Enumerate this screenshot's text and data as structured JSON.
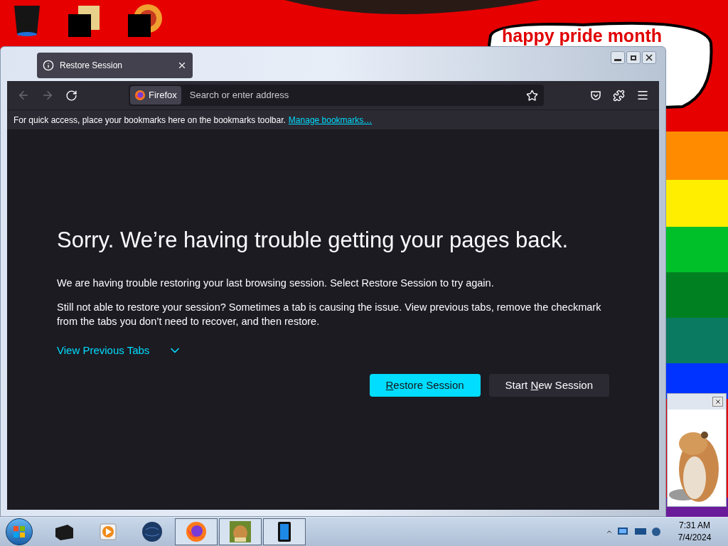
{
  "desktop": {
    "banner_text": "happy pride month",
    "icons": [
      {
        "kind": "bin"
      },
      {
        "kind": "folder"
      },
      {
        "kind": "globe"
      }
    ]
  },
  "window": {
    "tab": {
      "title": "Restore Session",
      "selected": true
    }
  },
  "toolbar": {
    "identity_label": "Firefox",
    "address": {
      "placeholder": "Search or enter address"
    }
  },
  "bookmarks_bar": {
    "message": "For quick access, place your bookmarks here on the bookmarks toolbar.",
    "link": "Manage bookmarks…"
  },
  "error_page": {
    "heading": "Sorry. We’re having trouble getting your pages back.",
    "paragraphs": [
      "We are having trouble restoring your last browsing session. Select Restore Session to try again.",
      "Still not able to restore your session? Sometimes a tab is causing the issue. View previous tabs, remove the checkmark from the tabs you don’t need to recover, and then restore."
    ],
    "toggle": {
      "label": "View Previous Tabs",
      "expanded": false
    },
    "buttons": [
      {
        "access_key": "R",
        "after": "estore Session",
        "kind": "primary"
      },
      {
        "before": "Start ",
        "access_key": "N",
        "after": "ew Session",
        "kind": "secondary"
      }
    ]
  },
  "taskbar": {
    "apps": [
      {
        "kind": "box",
        "running": false
      },
      {
        "kind": "player",
        "running": false
      },
      {
        "kind": "globe",
        "running": false
      },
      {
        "kind": "firefox",
        "running": true
      },
      {
        "kind": "hamster",
        "running": true
      },
      {
        "kind": "phone",
        "running": true
      }
    ],
    "clock": {
      "time": "7:31 AM",
      "date": "7/4/2024"
    }
  }
}
